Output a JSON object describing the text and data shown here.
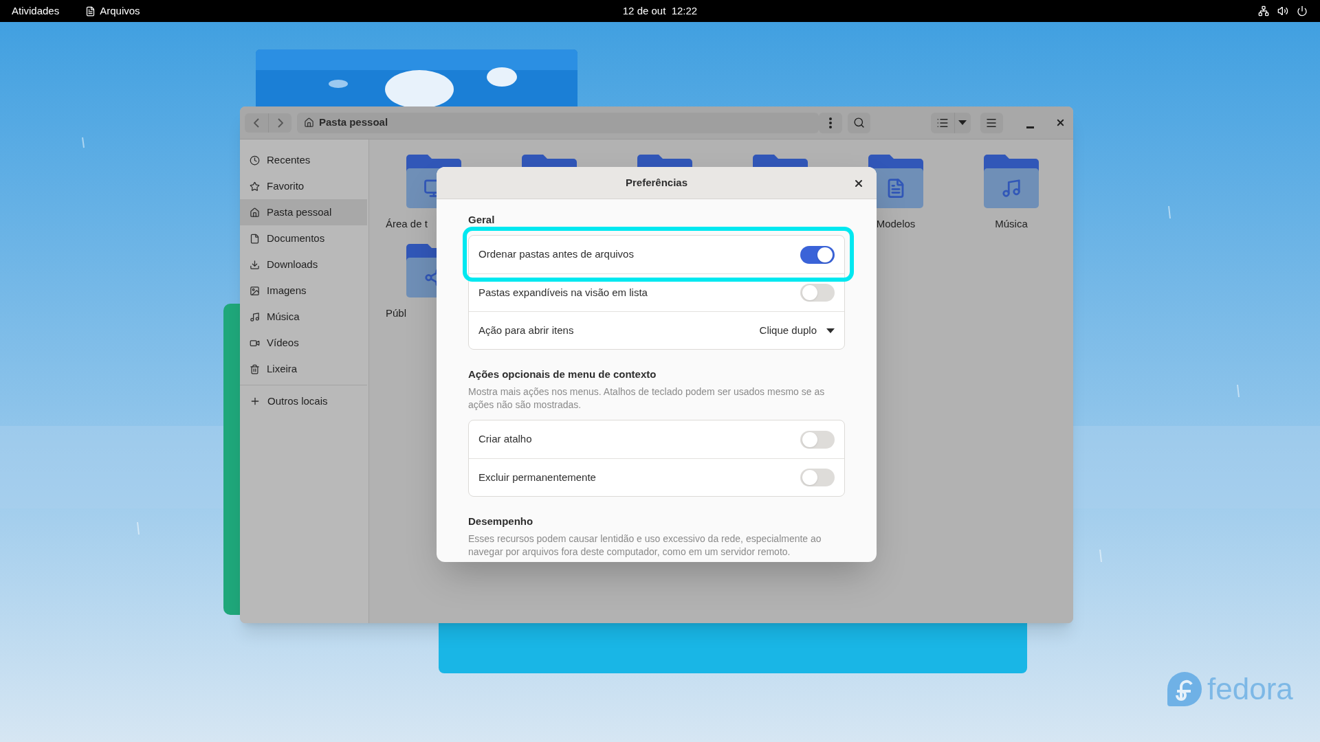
{
  "top_bar": {
    "activities": "Atividades",
    "app_name": "Arquivos",
    "clock": "12 de out  12:22"
  },
  "files_window": {
    "path": "Pasta pessoal",
    "sidebar": {
      "items": [
        {
          "label": "Recentes",
          "selected": false
        },
        {
          "label": "Favorito",
          "selected": false
        },
        {
          "label": "Pasta pessoal",
          "selected": true
        },
        {
          "label": "Documentos",
          "selected": false
        },
        {
          "label": "Downloads",
          "selected": false
        },
        {
          "label": "Imagens",
          "selected": false
        },
        {
          "label": "Música",
          "selected": false
        },
        {
          "label": "Vídeos",
          "selected": false
        },
        {
          "label": "Lixeira",
          "selected": false
        }
      ],
      "other_locations": "Outros locais"
    },
    "folders": [
      {
        "label": "Área de t",
        "kind": "cut"
      },
      {
        "label": "Modelos",
        "kind": "full"
      },
      {
        "label": "Música",
        "kind": "full"
      },
      {
        "label": "Públ",
        "kind": "cut"
      }
    ]
  },
  "dialog": {
    "title": "Preferências",
    "sections": [
      {
        "heading": "Geral",
        "rows": [
          {
            "kind": "switch",
            "label": "Ordenar pastas antes de arquivos",
            "on": true,
            "highlighted": true
          },
          {
            "kind": "switch",
            "label": "Pastas expandíveis na visão em lista",
            "on": false,
            "highlighted": false
          },
          {
            "kind": "dropdown",
            "label": "Ação para abrir itens",
            "value": "Clique duplo"
          }
        ]
      },
      {
        "heading": "Ações opcionais de menu de contexto",
        "description": "Mostra mais ações nos menus. Atalhos de teclado podem ser usados mesmo se as ações não são mostradas.",
        "rows": [
          {
            "kind": "switch",
            "label": "Criar atalho",
            "on": false,
            "highlighted": false
          },
          {
            "kind": "switch",
            "label": "Excluir permanentemente",
            "on": false,
            "highlighted": false
          }
        ]
      },
      {
        "heading": "Desempenho",
        "description": "Esses recursos podem causar lentidão e uso excessivo da rede, especialmente ao navegar por arquivos fora deste computador, como em um servidor remoto."
      }
    ]
  },
  "desktop": {
    "logo_text": "fedora"
  }
}
